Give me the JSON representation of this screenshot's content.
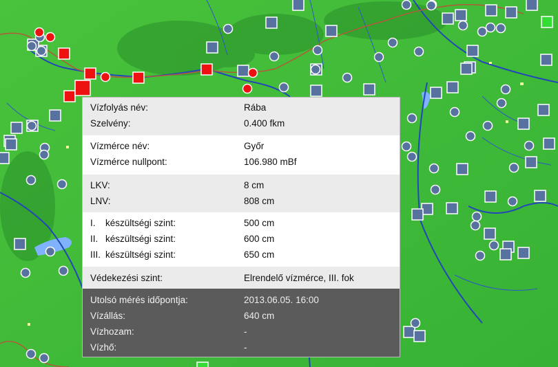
{
  "map": {
    "land_color": "#3fbf3a",
    "river_color": "#2346b8",
    "border_color": "#b25a3a",
    "lake_color": "#7fb3ff",
    "marker_colors": {
      "station": "#5872a0",
      "alert": "#ee1111",
      "normal": "#33dd33"
    },
    "marker_icon_names": [
      "square-station-marker",
      "circle-station-marker",
      "red-alert-marker",
      "green-normal-marker"
    ]
  },
  "tooltip": {
    "watercourse": {
      "label": "Vízfolyás név:",
      "value": "Rába"
    },
    "section": {
      "label": "Szelvény:",
      "value": "0.400 fkm"
    },
    "gauge_name": {
      "label": "Vízmérce név:",
      "value": "Győr"
    },
    "gauge_zero": {
      "label": "Vízmérce nullpont:",
      "value": "106.980 mBf"
    },
    "lkv": {
      "label": "LKV:",
      "value": "8 cm"
    },
    "lnv": {
      "label": "LNV:",
      "value": "808 cm"
    },
    "levels": [
      {
        "num": "I.",
        "label": "készültségi szint:",
        "value": "500 cm"
      },
      {
        "num": "II.",
        "label": "készültségi szint:",
        "value": "600 cm"
      },
      {
        "num": "III.",
        "label": "készültségi szint:",
        "value": "650 cm"
      }
    ],
    "defense": {
      "label": "Védekezési szint:",
      "value": "Elrendelő vízmérce, III. fok"
    },
    "last_measure_time": {
      "label": "Utolsó mérés időpontja:",
      "value": "2013.06.05. 16:00"
    },
    "water_level": {
      "label": "Vízállás:",
      "value": "640 cm"
    },
    "discharge": {
      "label": "Vízhozam:",
      "value": "-"
    },
    "water_temp": {
      "label": "Vízhő:",
      "value": "-"
    }
  }
}
